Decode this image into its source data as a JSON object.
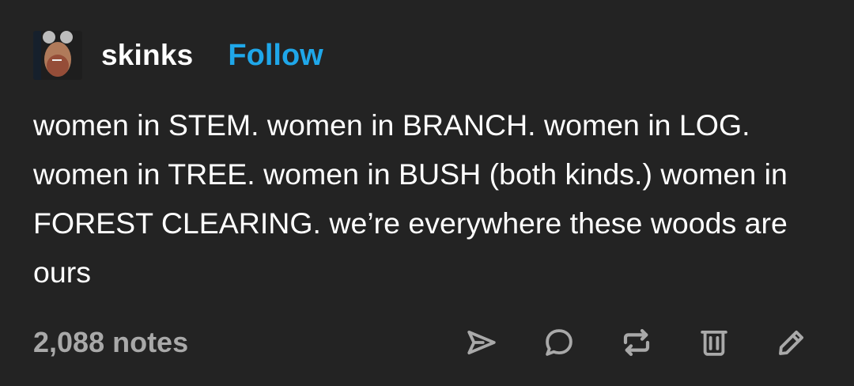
{
  "post": {
    "username": "skinks",
    "follow_label": "Follow",
    "text": "women in STEM. women in BRANCH. women in LOG. women in TREE. women in BUSH (both kinds.) women in FOREST CLEARING. we’re everywhere these woods are ours",
    "notes": "2,088 notes"
  },
  "icons": [
    "send-icon",
    "comment-icon",
    "reblog-icon",
    "delete-icon",
    "edit-icon"
  ],
  "colors": {
    "background": "#232323",
    "text": "#ffffff",
    "accent": "#1fa7e9",
    "muted": "#a9a9a9"
  }
}
